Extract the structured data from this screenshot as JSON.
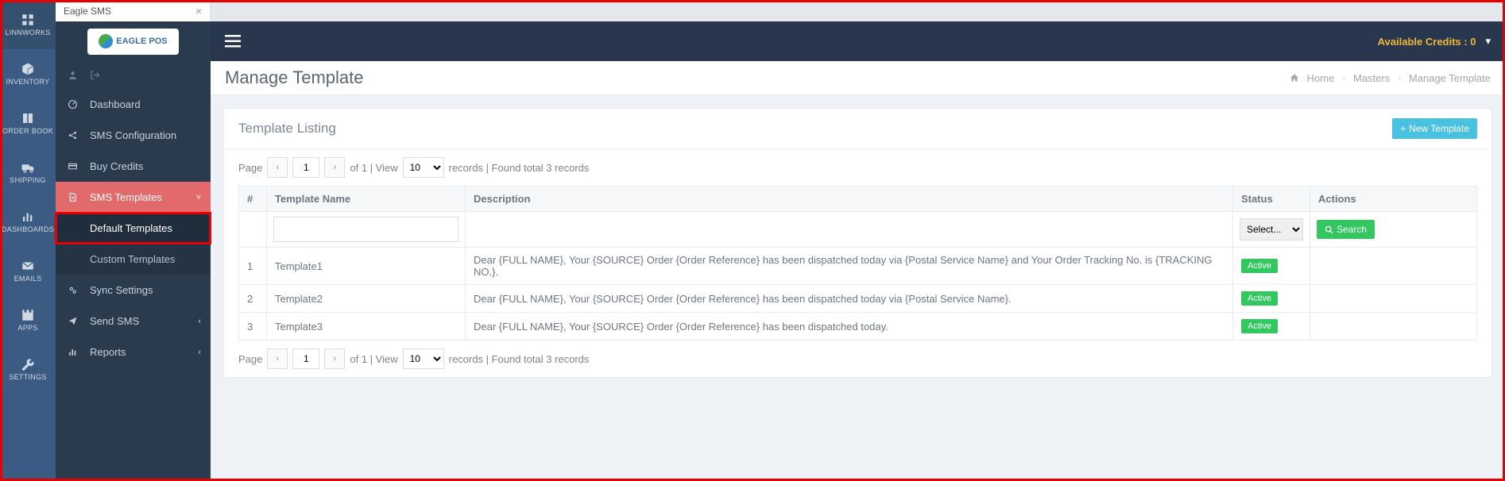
{
  "linnworks_rail": [
    {
      "label": "LINNWORKS",
      "svg": "grid"
    },
    {
      "label": "INVENTORY",
      "svg": "boxes"
    },
    {
      "label": "ORDER BOOK",
      "svg": "book"
    },
    {
      "label": "SHIPPING",
      "svg": "truck"
    },
    {
      "label": "DASHBOARDS",
      "svg": "chart"
    },
    {
      "label": "EMAILS",
      "svg": "mail"
    },
    {
      "label": "APPS",
      "svg": "puzzle"
    },
    {
      "label": "SETTINGS",
      "svg": "wrench"
    }
  ],
  "tab_name": "Eagle SMS",
  "logo_text": "EAGLE POS",
  "credits_label": "Available Credits :",
  "credits_value": "0",
  "page_title": "Manage Template",
  "breadcrumb": {
    "home": "Home",
    "mid": "Masters",
    "leaf": "Manage Template"
  },
  "sidebar": {
    "items": [
      {
        "icon": "dashboard",
        "label": "Dashboard",
        "expand": false
      },
      {
        "icon": "share",
        "label": "SMS Configuration",
        "expand": false
      },
      {
        "icon": "card",
        "label": "Buy Credits",
        "expand": false
      },
      {
        "icon": "doc",
        "label": "SMS Templates",
        "expand": true,
        "active": true,
        "children": [
          {
            "label": "Default Templates",
            "highlight": true,
            "hover": true
          },
          {
            "label": "Custom Templates"
          }
        ]
      },
      {
        "icon": "gears",
        "label": "Sync Settings",
        "expand": false
      },
      {
        "icon": "send",
        "label": "Send SMS",
        "expand": true
      },
      {
        "icon": "bar",
        "label": "Reports",
        "expand": true
      }
    ]
  },
  "panel_title": "Template Listing",
  "btn_new_label": "New Template",
  "pager": {
    "page_label": "Page",
    "page_value": "1",
    "of_label": "of 1 | View",
    "view_value": "10",
    "records_label": "records | Found total 3 records"
  },
  "table": {
    "headers": {
      "num": "#",
      "name": "Template Name",
      "desc": "Description",
      "status": "Status",
      "actions": "Actions"
    },
    "filter": {
      "status_placeholder": "Select...",
      "search_label": "Search"
    },
    "rows": [
      {
        "num": "1",
        "name": "Template1",
        "desc": "Dear {FULL NAME}, Your {SOURCE} Order {Order Reference} has been dispatched today via {Postal Service Name} and Your Order Tracking No. is {TRACKING NO.}.",
        "status": "Active"
      },
      {
        "num": "2",
        "name": "Template2",
        "desc": "Dear {FULL NAME}, Your {SOURCE} Order {Order Reference} has been dispatched today via {Postal Service Name}.",
        "status": "Active"
      },
      {
        "num": "3",
        "name": "Template3",
        "desc": "Dear {FULL NAME}, Your {SOURCE} Order {Order Reference} has been dispatched today.",
        "status": "Active"
      }
    ]
  }
}
